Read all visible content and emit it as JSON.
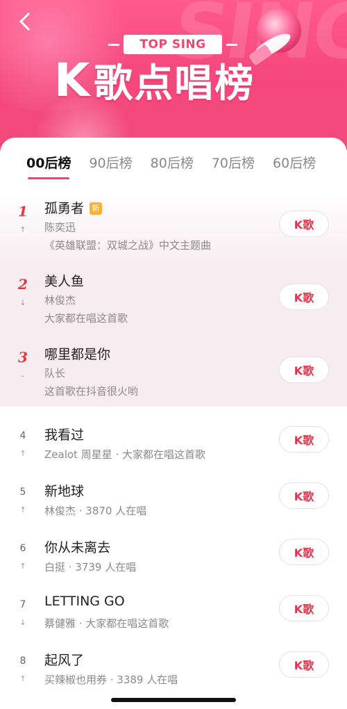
{
  "header": {
    "back_icon": "chevron-left-icon",
    "top_sing_label": "TOP SING",
    "title_k": "K",
    "title_cn": "歌点唱榜",
    "mic_icon": "microphone-icon",
    "colors": {
      "banner": "#f5487c",
      "accent": "#f0436f",
      "rank_red": "#e8353e"
    }
  },
  "tabs": [
    {
      "label": "00后榜",
      "active": true
    },
    {
      "label": "90后榜",
      "active": false
    },
    {
      "label": "80后榜",
      "active": false
    },
    {
      "label": "70后榜",
      "active": false
    },
    {
      "label": "60后榜",
      "active": false
    }
  ],
  "songs": [
    {
      "rank": "1",
      "trend": "↑",
      "title": "孤勇者",
      "badge": "新",
      "line1": "陈奕迅",
      "line2": "《英雄联盟：双城之战》中文主题曲",
      "button": "K歌"
    },
    {
      "rank": "2",
      "trend": "↓",
      "title": "美人鱼",
      "line1": "林俊杰",
      "line2": "大家都在唱这首歌",
      "button": "K歌"
    },
    {
      "rank": "3",
      "trend": "–",
      "title": "哪里都是你",
      "line1": "队长",
      "line2": "这首歌在抖音很火哟",
      "button": "K歌"
    },
    {
      "rank": "4",
      "trend": "↑",
      "title": "我看过",
      "line1": "Zealot 周星星 · 大家都在唱这首歌",
      "button": "K歌"
    },
    {
      "rank": "5",
      "trend": "↑",
      "title": "新地球",
      "line1": "林俊杰 · 3870 人在唱",
      "button": "K歌"
    },
    {
      "rank": "6",
      "trend": "↑",
      "title": "你从未离去",
      "line1": "白挺 · 3739 人在唱",
      "button": "K歌"
    },
    {
      "rank": "7",
      "trend": "↓",
      "title": "LETTING GO",
      "line1": "蔡健雅 · 大家都在唱这首歌",
      "button": "K歌"
    },
    {
      "rank": "8",
      "trend": "↑",
      "title": "起风了",
      "line1": "买辣椒也用券 · 3389 人在唱",
      "button": "K歌"
    }
  ]
}
